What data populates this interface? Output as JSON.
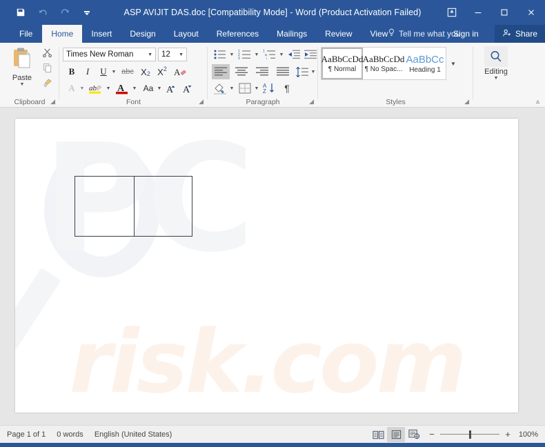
{
  "window": {
    "title": "ASP AVIJIT DAS.doc [Compatibility Mode] - Word (Product Activation Failed)",
    "quick_access": [
      {
        "name": "save",
        "label": "Save"
      },
      {
        "name": "undo",
        "label": "Undo"
      },
      {
        "name": "redo",
        "label": "Redo"
      },
      {
        "name": "customize",
        "label": "Customize Quick Access Toolbar"
      }
    ],
    "controls": [
      {
        "name": "ribbon-display-options",
        "label": "Ribbon Display Options"
      },
      {
        "name": "minimize",
        "label": "Minimize"
      },
      {
        "name": "maximize",
        "label": "Maximize"
      },
      {
        "name": "close",
        "label": "Close"
      }
    ]
  },
  "tabs": [
    {
      "label": "File",
      "active": false
    },
    {
      "label": "Home",
      "active": true
    },
    {
      "label": "Insert",
      "active": false
    },
    {
      "label": "Design",
      "active": false
    },
    {
      "label": "Layout",
      "active": false
    },
    {
      "label": "References",
      "active": false
    },
    {
      "label": "Mailings",
      "active": false
    },
    {
      "label": "Review",
      "active": false
    },
    {
      "label": "View",
      "active": false
    }
  ],
  "tellme": {
    "placeholder": "Tell me what you want to do"
  },
  "signin": {
    "label": "Sign in"
  },
  "share": {
    "label": "Share"
  },
  "ribbon": {
    "clipboard": {
      "group_label": "Clipboard",
      "paste_label": "Paste",
      "cut_label": "Cut",
      "copy_label": "Copy",
      "format_painter_label": "Format Painter"
    },
    "font": {
      "group_label": "Font",
      "font_name": "Times New Roman",
      "font_size": "12",
      "bold": "B",
      "italic": "I",
      "underline": "U",
      "strikethrough": "abc",
      "subscript": "X",
      "superscript": "X",
      "text_effects": "A",
      "highlight": "ab",
      "font_color": "A",
      "change_case": "Aa",
      "grow_font": "A",
      "shrink_font": "A"
    },
    "paragraph": {
      "group_label": "Paragraph",
      "bullets": "Bullets",
      "numbering": "Numbering",
      "multilevel": "Multilevel List",
      "decrease_indent": "Decrease Indent",
      "increase_indent": "Increase Indent",
      "align_left": "Align Left",
      "align_center": "Center",
      "align_right": "Align Right",
      "justify": "Justify",
      "line_spacing": "Line and Paragraph Spacing",
      "shading": "Shading",
      "borders": "Borders",
      "sort": "Sort",
      "show_marks": "¶"
    },
    "styles": {
      "group_label": "Styles",
      "items": [
        {
          "sample": "AaBbCcDd",
          "name": "¶ Normal",
          "selected": true
        },
        {
          "sample": "AaBbCcDd",
          "name": "¶ No Spac...",
          "selected": false
        },
        {
          "sample": "AaBbCc",
          "name": "Heading 1",
          "selected": false
        }
      ],
      "more_label": "More"
    },
    "editing": {
      "group_label": "Editing",
      "label": "Editing"
    },
    "collapse_label": "Collapse the Ribbon"
  },
  "document": {
    "watermark_top": "PC",
    "watermark_bottom": "risk.com",
    "table": {
      "rows": 1,
      "columns": 2
    }
  },
  "status": {
    "page": "Page 1 of 1",
    "words": "0 words",
    "language": "English (United States)",
    "views": [
      {
        "name": "read-mode",
        "label": "Read Mode",
        "active": false
      },
      {
        "name": "print-layout",
        "label": "Print Layout",
        "active": true
      },
      {
        "name": "web-layout",
        "label": "Web Layout",
        "active": false
      }
    ],
    "zoom_out": "−",
    "zoom_in": "+",
    "zoom_level": "100%"
  },
  "colors": {
    "brand": "#2b579a",
    "share_bg": "#204b87",
    "ribbon_bg": "#f6f6f6",
    "doc_bg": "#e6e6e6",
    "status_bg": "#f0f0f0",
    "table_border": "#3b3f46",
    "watermark_pc": "#f4f5f7",
    "watermark_risk": "#fdf2ea"
  }
}
